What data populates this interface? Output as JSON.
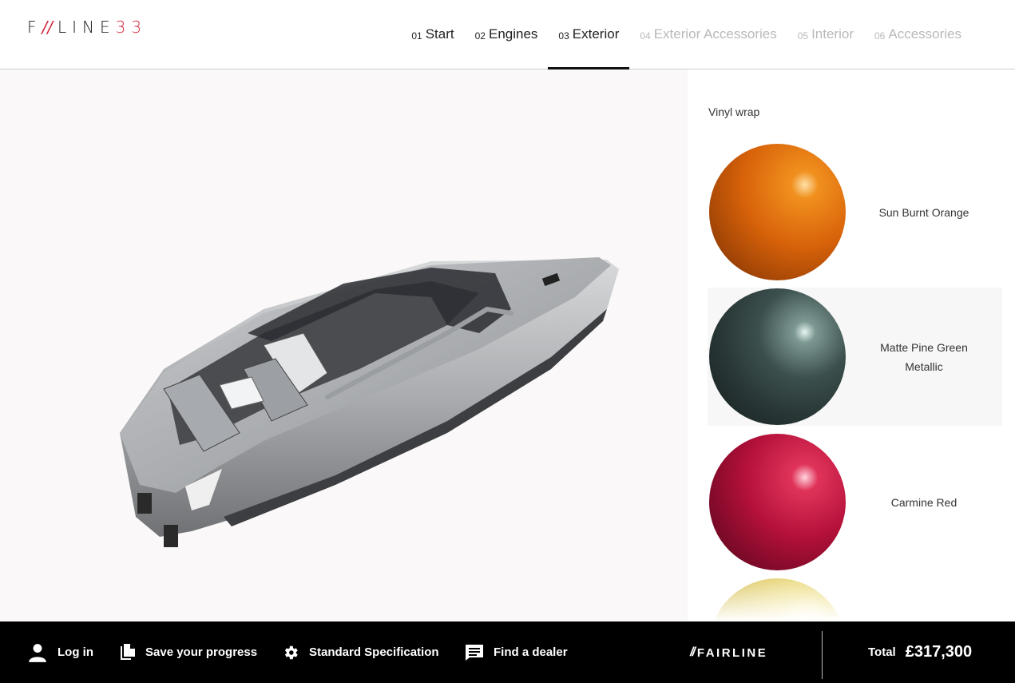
{
  "header": {
    "logo": {
      "left": "F",
      "slash": "//",
      "word": "LINE",
      "number": "33"
    },
    "steps": [
      {
        "index": "01",
        "label": "Start",
        "state": "enabled"
      },
      {
        "index": "02",
        "label": "Engines",
        "state": "enabled"
      },
      {
        "index": "03",
        "label": "Exterior",
        "state": "active"
      },
      {
        "index": "04",
        "label": "Exterior Accessories",
        "state": "disabled"
      },
      {
        "index": "05",
        "label": "Interior",
        "state": "disabled"
      },
      {
        "index": "06",
        "label": "Accessories",
        "state": "disabled"
      }
    ]
  },
  "panel": {
    "title": "Vinyl wrap",
    "options": [
      {
        "label": "Sun Burnt Orange",
        "color": "#d9630a",
        "selected": false
      },
      {
        "label": "Matte Pine Green Metallic",
        "color": "#2c3d3c",
        "selected": true
      },
      {
        "label": "Carmine Red",
        "color": "#b3103a",
        "selected": false
      },
      {
        "label": "",
        "color": "#e8d978",
        "selected": false
      }
    ]
  },
  "footer": {
    "login": "Log in",
    "save": "Save your progress",
    "spec": "Standard Specification",
    "dealer": "Find a dealer",
    "brand": "FAIRLINE",
    "total_label": "Total",
    "total_value": "£317,300"
  },
  "colors": {
    "accent": "#d0253a",
    "footer_bg": "#000000"
  }
}
